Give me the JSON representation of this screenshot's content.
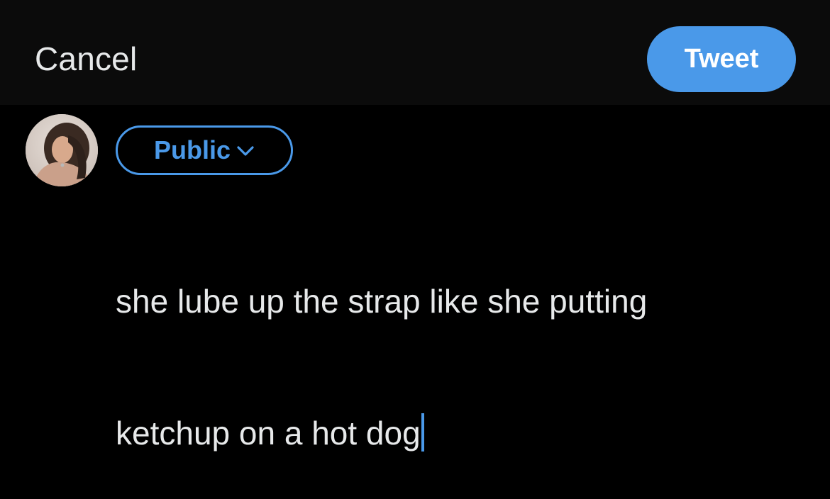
{
  "header": {
    "cancel_label": "Cancel",
    "tweet_label": "Tweet"
  },
  "audience": {
    "label": "Public",
    "icon": "chevron-down-icon"
  },
  "composer": {
    "line1": "she lube up the strap like she putting",
    "line2": "ketchup on a hot dog"
  },
  "colors": {
    "accent": "#4a99e9",
    "background": "#000000",
    "header_background": "#0b0b0b",
    "text": "#e7e9ea"
  }
}
